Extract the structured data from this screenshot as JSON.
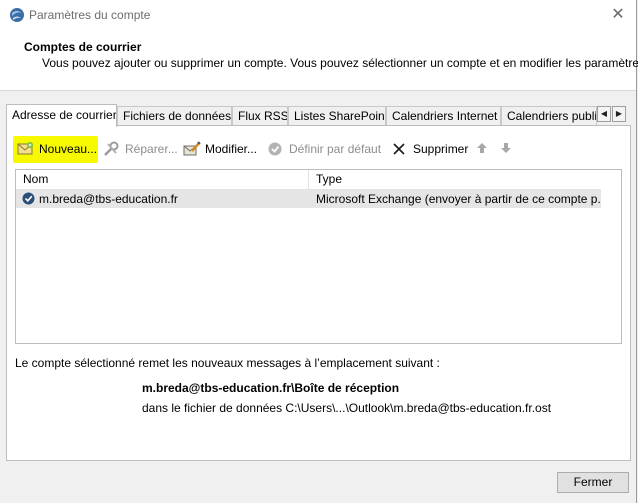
{
  "window": {
    "title": "Paramètres du compte",
    "close_symbol": "✕"
  },
  "header": {
    "title": "Comptes de courrier",
    "description": "Vous pouvez ajouter ou supprimer un compte. Vous pouvez sélectionner un compte et en modifier les paramètres."
  },
  "tabs": [
    {
      "label": "Adresse de courrier",
      "active": true
    },
    {
      "label": "Fichiers de données",
      "active": false
    },
    {
      "label": "Flux RSS",
      "active": false
    },
    {
      "label": "Listes SharePoint",
      "active": false
    },
    {
      "label": "Calendriers Internet",
      "active": false
    },
    {
      "label": "Calendriers publiés",
      "active": false
    }
  ],
  "tab_scroll": {
    "left": "◀",
    "right": "▶"
  },
  "toolbar": {
    "new_label": "Nouveau...",
    "repair_label": "Réparer...",
    "modify_label": "Modifier...",
    "default_label": "Définir par défaut",
    "delete_label": "Supprimer",
    "highlight_color": "#f7f900"
  },
  "account_list": {
    "columns": [
      "Nom",
      "Type"
    ],
    "rows": [
      {
        "name": "m.breda@tbs-education.fr",
        "type": "Microsoft Exchange (envoyer à partir de ce compte p..."
      }
    ]
  },
  "delivery_info": {
    "intro": "Le compte sélectionné remet les nouveaux messages à l’emplacement suivant :",
    "location": "m.breda@tbs-education.fr\\Boîte de réception",
    "data_file": "dans le fichier de données C:\\Users\\...\\Outlook\\m.breda@tbs-education.fr.ost"
  },
  "footer": {
    "close_label": "Fermer"
  }
}
